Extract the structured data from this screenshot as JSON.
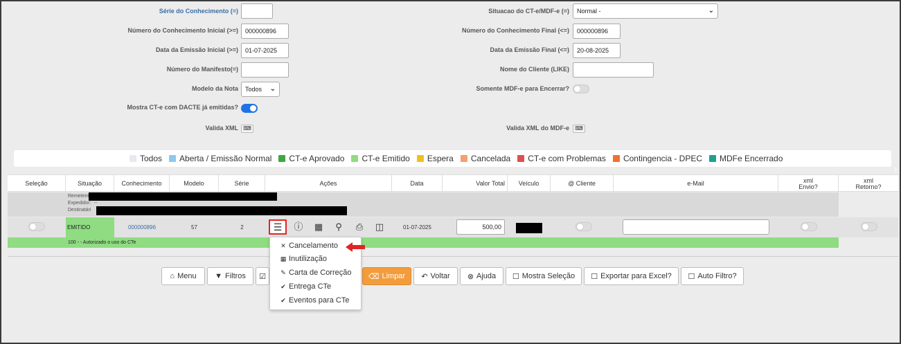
{
  "filters": {
    "serie_label": "Série do Conhecimento (=)",
    "num_inicial_label": "Número do Conhecimento Inicial (>=)",
    "num_inicial_value": "000000896",
    "data_inicial_label": "Data da Emissão Inicial (>=)",
    "data_inicial_value": "01-07-2025",
    "manifesto_label": "Número do Manifesto(=)",
    "modelo_label": "Modelo da Nota",
    "modelo_value": "Todos",
    "mostra_dacte_label": "Mostra CT-e com DACTE já emitidas?",
    "valida_xml_label": "Valida XML",
    "situacao_label": "Situacao do CT-e/MDF-e (=)",
    "situacao_value": "Normal -",
    "num_final_label": "Número do Conhecimento Final (<=)",
    "num_final_value": "000000896",
    "data_final_label": "Data da Emissão Final (<=)",
    "data_final_value": "20-08-2025",
    "nome_cliente_label": "Nome do Cliente (LIKE)",
    "somente_mdfe_label": "Somente MDF-e para Encerrar?",
    "valida_xml_mdfe_label": "Valida XML do MDF-e",
    "xml_btn_glyph": "⌨"
  },
  "legend": [
    {
      "label": "Todos",
      "color": "#e8e8f0"
    },
    {
      "label": "Aberta / Emissão Normal",
      "color": "#8ec8f0"
    },
    {
      "label": "CT-e Aprovado",
      "color": "#3fa83f"
    },
    {
      "label": "CT-e Emitido",
      "color": "#8fdc82"
    },
    {
      "label": "Espera",
      "color": "#f0c020"
    },
    {
      "label": "Cancelada",
      "color": "#f5a070"
    },
    {
      "label": "CT-e com Problemas",
      "color": "#e05050"
    },
    {
      "label": "Contingencia - DPEC",
      "color": "#f07030"
    },
    {
      "label": "MDFe Encerrado",
      "color": "#20a090"
    }
  ],
  "grid": {
    "headers": {
      "selecao": "Seleção",
      "situacao": "Situação",
      "conhecimento": "Conhecimento",
      "modelo": "Modelo",
      "serie": "Série",
      "acoes": "Ações",
      "data": "Data",
      "valor_total": "Valor Total",
      "veiculo": "Veículo",
      "cliente": "@ Cliente",
      "email": "e-Mail",
      "xml_envio_1": "xml",
      "xml_envio_2": "Envio?",
      "xml_retorno_1": "xml",
      "xml_retorno_2": "Retorno?"
    },
    "info_labels": {
      "remetente": "Remetente:",
      "expedidor": "Expedidor:",
      "expedidor_value": "--",
      "destinatario": "Destinatári"
    },
    "row": {
      "situacao": "EMITIDO",
      "conhecimento": "000000896",
      "modelo": "57",
      "serie": "2",
      "data": "01-07-2025",
      "valor_total": "500,00",
      "status": "100 - - Autorizado o uso do CTe"
    }
  },
  "buttons": {
    "menu": "Menu",
    "filtros": "Filtros",
    "limpar": "Limpar",
    "voltar": "Voltar",
    "ajuda": "Ajuda",
    "mostra_selecao": "Mostra Seleção",
    "exportar_excel": "Exportar para Excel?",
    "auto_filtro": "Auto Filtro?"
  },
  "dropdown": {
    "cancelamento": "Cancelamento",
    "inutilizacao": "Inutilização",
    "carta_correcao": "Carta de Correção",
    "entrega": "Entrega CTe",
    "eventos": "Eventos para CTe"
  },
  "colors": {
    "accent": "#1e73e8",
    "emitido_green": "#8fdc82",
    "highlight_red": "#e02424",
    "limpar_orange": "#f39c3c"
  }
}
